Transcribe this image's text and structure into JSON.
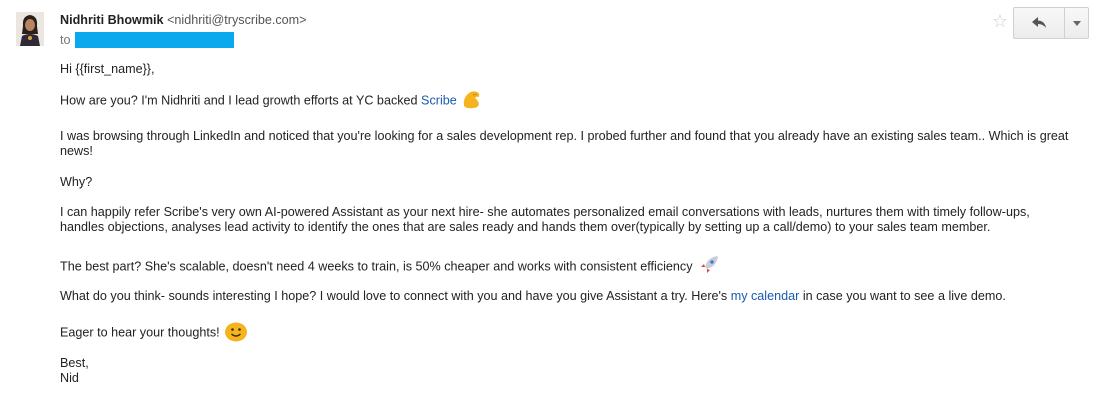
{
  "header": {
    "sender_name": "Nidhriti Bhowmik",
    "sender_email": "<nidhriti@tryscribe.com>",
    "to_label": "to"
  },
  "icons": {
    "avatar": "avatar",
    "star": "star-icon",
    "reply": "reply-icon",
    "more": "chevron-down-icon"
  },
  "message": {
    "greeting": "Hi {{first_name}},",
    "how_are_you": "How are you? I'm Nidhriti and I lead growth efforts at YC backed ",
    "scribe_link": "Scribe",
    "browsing": "I was browsing through LinkedIn and noticed that you're looking for a sales development rep. I probed further and found that you already have an existing sales team.. Which is great news!",
    "why": "Why?",
    "refer": "I can happily refer Scribe's very own AI-powered Assistant as your next hire- she automates personalized email conversations with leads, nurtures them with timely follow-ups, handles objections, analyses lead activity to identify the ones that are sales ready and hands them over(typically by setting up a call/demo) to your sales team member.",
    "best_part": "The best part? She's scalable, doesn't need 4 weeks to train, is 50% cheaper and works with consistent efficiency",
    "think_before": "What do you think- sounds interesting I hope? I would love to connect with you and have you give Assistant a try. Here's ",
    "calendar_link": "my calendar",
    "think_after": " in case you want to see a live demo.",
    "eager": "Eager to hear your thoughts!",
    "sign_best": "Best,",
    "sign_name": "Nid"
  },
  "colors": {
    "link": "#1a5ab0",
    "redacted": "#0aa8ec",
    "emoji": "#f5b41f"
  }
}
